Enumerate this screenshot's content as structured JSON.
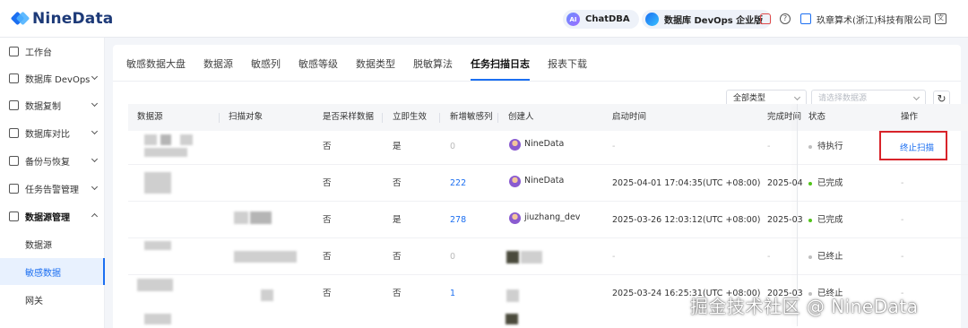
{
  "brand": {
    "name": "NineData"
  },
  "topbar": {
    "chatdba_label": "ChatDBA",
    "chatdba_badge": "AI",
    "edition_label": "数据库 DevOps 企业版",
    "org_name": "玖章算术(浙江)科技有限公司"
  },
  "sidebar": {
    "items": [
      {
        "label": "工作台"
      },
      {
        "label": "数据库 DevOps"
      },
      {
        "label": "数据复制"
      },
      {
        "label": "数据库对比"
      },
      {
        "label": "备份与恢复"
      },
      {
        "label": "任务告警管理"
      },
      {
        "label": "数据源管理"
      }
    ],
    "sub_items": [
      {
        "label": "数据源"
      },
      {
        "label": "敏感数据"
      },
      {
        "label": "网关"
      }
    ]
  },
  "tabs": [
    {
      "label": "敏感数据大盘"
    },
    {
      "label": "数据源"
    },
    {
      "label": "敏感列"
    },
    {
      "label": "敏感等级"
    },
    {
      "label": "数据类型"
    },
    {
      "label": "脱敏算法"
    },
    {
      "label": "任务扫描日志"
    },
    {
      "label": "报表下载"
    }
  ],
  "filters": {
    "type_value": "全部类型",
    "source_placeholder": "请选择数据源"
  },
  "table": {
    "headers": [
      "数据源",
      "扫描对象",
      "是否采样数据",
      "立即生效",
      "新增敏感列",
      "创建人",
      "启动时间",
      "完成时间",
      "状态",
      "操作"
    ],
    "rows": [
      {
        "sample": "否",
        "immediate": "是",
        "new_cols": "0",
        "creator": "NineData",
        "start": "-",
        "finish": "-",
        "status": "待执行",
        "action": "终止扫描"
      },
      {
        "sample": "否",
        "immediate": "否",
        "new_cols": "222",
        "creator": "NineData",
        "start": "2025-04-01 17:04:35(UTC +08:00)",
        "finish": "2025-04",
        "status": "已完成",
        "action": "-"
      },
      {
        "sample": "否",
        "immediate": "是",
        "new_cols": "278",
        "creator": "jiuzhang_dev",
        "start": "2025-03-26 12:03:12(UTC +08:00)",
        "finish": "2025-03",
        "status": "已完成",
        "action": "-"
      },
      {
        "sample": "否",
        "immediate": "否",
        "new_cols": "0",
        "creator": "",
        "start": "-",
        "finish": "-",
        "status": "已终止",
        "action": "-"
      },
      {
        "sample": "否",
        "immediate": "否",
        "new_cols": "1",
        "creator": "",
        "start": "2025-03-24 16:25:31(UTC +08:00)",
        "finish": "2025-03",
        "status": "已终止",
        "action": "-"
      }
    ]
  },
  "colors": {
    "accent": "#1c6ff1",
    "success": "#52c41a",
    "muted": "#bfbfbf",
    "highlight": "#d8232a"
  },
  "watermark": "掘金技术社区 @ NineData"
}
